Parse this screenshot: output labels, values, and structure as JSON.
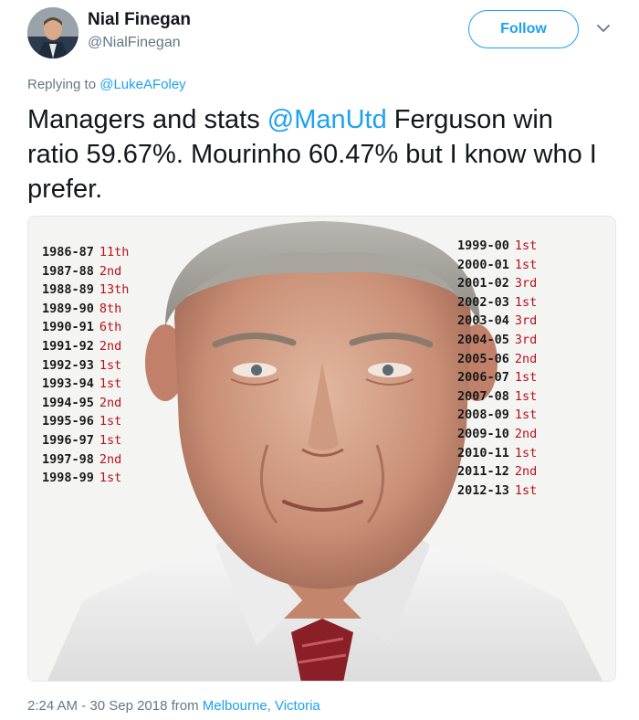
{
  "header": {
    "name": "Nial Finegan",
    "handle": "@NialFinegan",
    "follow_label": "Follow"
  },
  "reply": {
    "prefix": "Replying to ",
    "to": "@LukeAFoley"
  },
  "tweet": {
    "part1": "Managers and stats ",
    "mention": "@ManUtd",
    "part2": " Ferguson win ratio 59.67%. Mourinho 60.47% but I know who I prefer."
  },
  "media": {
    "seasons_left": [
      {
        "season": "1986-87",
        "position": "11th"
      },
      {
        "season": "1987-88",
        "position": "2nd"
      },
      {
        "season": "1988-89",
        "position": "13th"
      },
      {
        "season": "1989-90",
        "position": "8th"
      },
      {
        "season": "1990-91",
        "position": "6th"
      },
      {
        "season": "1991-92",
        "position": "2nd"
      },
      {
        "season": "1992-93",
        "position": "1st"
      },
      {
        "season": "1993-94",
        "position": "1st"
      },
      {
        "season": "1994-95",
        "position": "2nd"
      },
      {
        "season": "1995-96",
        "position": "1st"
      },
      {
        "season": "1996-97",
        "position": "1st"
      },
      {
        "season": "1997-98",
        "position": "2nd"
      },
      {
        "season": "1998-99",
        "position": "1st"
      }
    ],
    "seasons_right": [
      {
        "season": "1999-00",
        "position": "1st"
      },
      {
        "season": "2000-01",
        "position": "1st"
      },
      {
        "season": "2001-02",
        "position": "3rd"
      },
      {
        "season": "2002-03",
        "position": "1st"
      },
      {
        "season": "2003-04",
        "position": "3rd"
      },
      {
        "season": "2004-05",
        "position": "3rd"
      },
      {
        "season": "2005-06",
        "position": "2nd"
      },
      {
        "season": "2006-07",
        "position": "1st"
      },
      {
        "season": "2007-08",
        "position": "1st"
      },
      {
        "season": "2008-09",
        "position": "1st"
      },
      {
        "season": "2009-10",
        "position": "2nd"
      },
      {
        "season": "2010-11",
        "position": "1st"
      },
      {
        "season": "2011-12",
        "position": "2nd"
      },
      {
        "season": "2012-13",
        "position": "1st"
      }
    ]
  },
  "footer": {
    "time": "2:24 AM - 30 Sep 2018 from ",
    "location": "Melbourne, Victoria"
  },
  "colors": {
    "accent": "#1da1f2",
    "secondary_text": "#657786",
    "position_red": "#b5131b"
  },
  "icons": {
    "caret": "chevron-down-icon"
  }
}
